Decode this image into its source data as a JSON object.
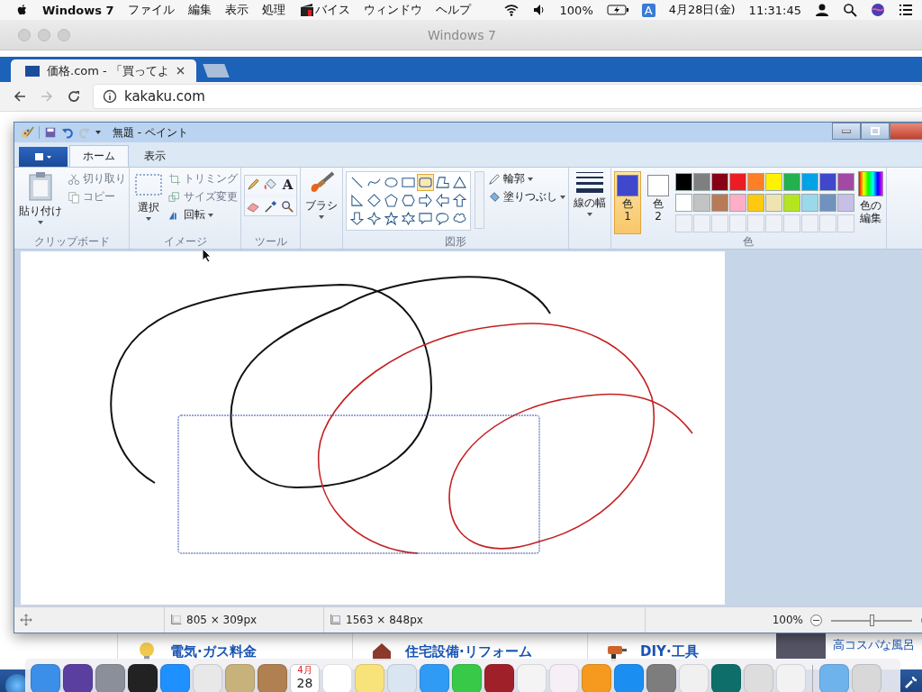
{
  "menu_bar": {
    "app": "Windows 7",
    "menus": [
      "ファイル",
      "編集",
      "表示",
      "処理",
      "バイス",
      "ウィンドウ",
      "ヘルプ"
    ],
    "battery": "100%",
    "input_source": "A",
    "date": "4月28日(金)",
    "time": "11:31:45"
  },
  "vm_window": {
    "title": "Windows 7"
  },
  "browser": {
    "tabs": [
      {
        "title": "価格.com - 「買ってよ",
        "selected": true
      }
    ],
    "url": "kakaku.com"
  },
  "web_page": {
    "categories": [
      "電気·ガス料金",
      "住宅設備·リフォーム",
      "DIY·工具"
    ],
    "ad_text": "高コスパな風呂"
  },
  "paint": {
    "title": "無題 - ペイント",
    "tabs": [
      {
        "label": "ホーム",
        "selected": true
      },
      {
        "label": "表示",
        "selected": false
      }
    ],
    "clipboard": {
      "label": "クリップボード",
      "paste": "貼り付け",
      "cut": "切り取り",
      "copy": "コピー"
    },
    "image": {
      "label": "イメージ",
      "select": "選択",
      "crop": "トリミング",
      "resize": "サイズ変更",
      "rotate": "回転"
    },
    "tools": {
      "label": "ツール",
      "text_tool": "A"
    },
    "brushes": {
      "label": "ブラシ"
    },
    "shapes": {
      "label": "図形",
      "outline": "輪郭",
      "fill": "塗りつぶし",
      "items": [
        {
          "kind": "line",
          "selected": false
        },
        {
          "kind": "curve",
          "selected": false
        },
        {
          "kind": "oval",
          "selected": false
        },
        {
          "kind": "rectangle",
          "selected": false
        },
        {
          "kind": "rounded",
          "selected": true
        },
        {
          "kind": "polygon",
          "selected": false
        },
        {
          "kind": "triangle",
          "selected": false
        },
        {
          "kind": "right-triangle",
          "selected": false
        },
        {
          "kind": "diamond",
          "selected": false
        },
        {
          "kind": "pentagon",
          "selected": false
        },
        {
          "kind": "hexagon",
          "selected": false
        },
        {
          "kind": "arrow-right",
          "selected": false
        },
        {
          "kind": "arrow-left",
          "selected": false
        },
        {
          "kind": "arrow-up",
          "selected": false
        },
        {
          "kind": "arrow-down",
          "selected": false
        },
        {
          "kind": "star4",
          "selected": false
        },
        {
          "kind": "star5",
          "selected": false
        },
        {
          "kind": "star6",
          "selected": false
        },
        {
          "kind": "callout-rect",
          "selected": false
        },
        {
          "kind": "callout-oval",
          "selected": false
        },
        {
          "kind": "callout-cloud",
          "selected": false
        }
      ]
    },
    "size": {
      "label": "線の幅"
    },
    "colors": {
      "label": "色",
      "color1": {
        "label": "色",
        "number": "1",
        "color": "#3f48cc",
        "selected": true
      },
      "color2": {
        "label": "色",
        "number": "2",
        "color": "#ffffff",
        "selected": false
      },
      "palette": [
        {
          "color": "#000000"
        },
        {
          "color": "#7f7f7f"
        },
        {
          "color": "#880015"
        },
        {
          "color": "#ed1c24"
        },
        {
          "color": "#ff7f27"
        },
        {
          "color": "#fff200"
        },
        {
          "color": "#22b14c"
        },
        {
          "color": "#00a2e8"
        },
        {
          "color": "#3f48cc"
        },
        {
          "color": "#a349a4"
        },
        {
          "color": "#ffffff"
        },
        {
          "color": "#c3c3c3"
        },
        {
          "color": "#b97a57"
        },
        {
          "color": "#ffaec9"
        },
        {
          "color": "#ffc90e"
        },
        {
          "color": "#efe4b0"
        },
        {
          "color": "#b5e61d"
        },
        {
          "color": "#99d9ea"
        },
        {
          "color": "#7092be"
        },
        {
          "color": "#c8bfe7"
        }
      ],
      "edit": "色の編集"
    },
    "status": {
      "selection_size": "805 × 309px",
      "image_size": "1563 × 848px",
      "zoom": "100%",
      "level": 0.5
    }
  },
  "dock": {
    "calendar_month": "4月",
    "calendar_day": "28"
  }
}
